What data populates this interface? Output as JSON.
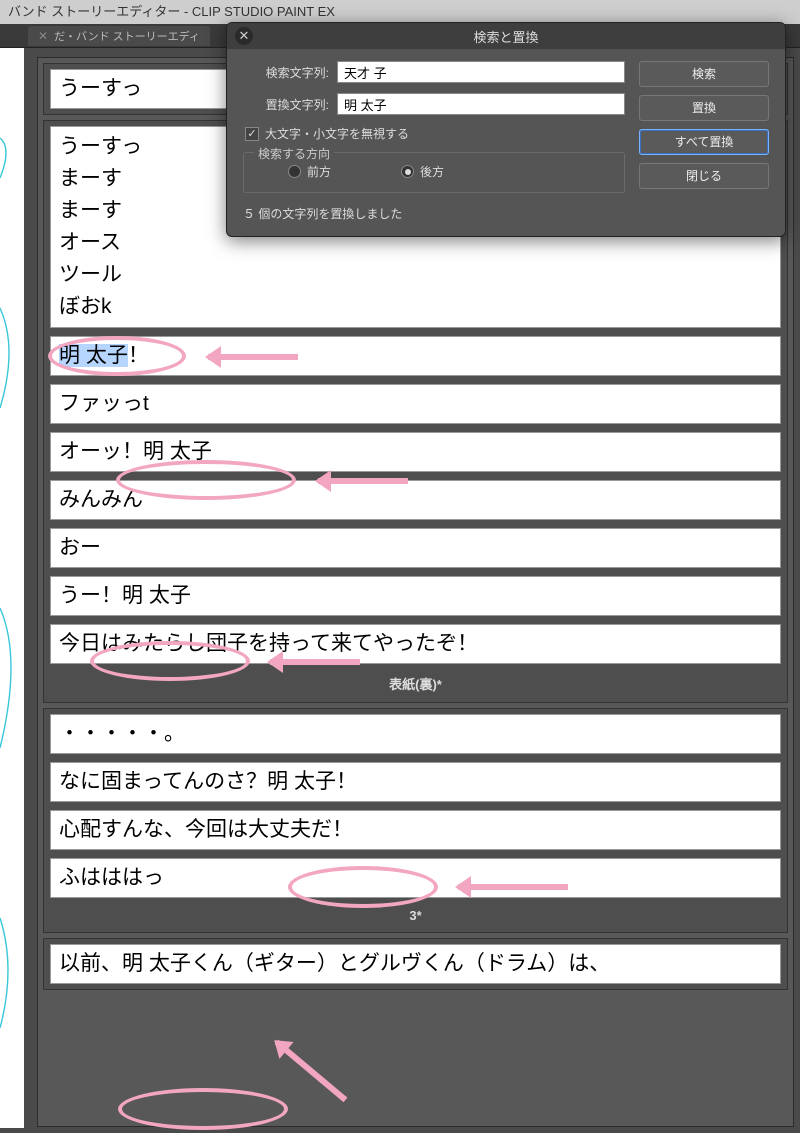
{
  "window": {
    "title": "バンド ストーリーエディター - CLIP STUDIO PAINT EX"
  },
  "tab": {
    "label": "だ・バンド ストーリーエディ"
  },
  "dialog": {
    "title": "検索と置換",
    "search_label": "検索文字列:",
    "replace_label": "置換文字列:",
    "search_value": "天才 子",
    "replace_value": "明 太子",
    "ignore_case_label": "大文字・小文字を無視する",
    "direction_legend": "検索する方向",
    "direction_forward": "前方",
    "direction_backward": "後方",
    "status": "５ 個の文字列を置換しました",
    "btn_search": "検索",
    "btn_replace": "置換",
    "btn_replace_all": "すべて置換",
    "btn_close": "閉じる"
  },
  "pages": [
    {
      "label": null,
      "boxes": [
        {
          "lines": [
            "うーすっ"
          ]
        }
      ]
    },
    {
      "label": "表紙(裏)*",
      "boxes": [
        {
          "lines": [
            "うーすっ",
            "まーす",
            "まーす",
            "オース",
            "ツール",
            "ぼおk"
          ]
        },
        {
          "lines": [
            "明 太子！"
          ],
          "highlight": "明 太子"
        },
        {
          "lines": [
            "ファッっt"
          ]
        },
        {
          "lines": [
            "オーッ！明 太子"
          ]
        },
        {
          "lines": [
            "みんみん"
          ]
        },
        {
          "lines": [
            "おー"
          ]
        },
        {
          "lines": [
            "うー！明 太子"
          ]
        },
        {
          "lines": [
            "今日はみたらし団子を持って来てやったぞ！"
          ]
        }
      ]
    },
    {
      "label": "3*",
      "boxes": [
        {
          "lines": [
            "・・・・・。"
          ]
        },
        {
          "lines": [
            "なに固まってんのさ？明 太子！"
          ]
        },
        {
          "lines": [
            "心配すんな、今回は大丈夫だ！"
          ]
        },
        {
          "lines": [
            "ふはははっ"
          ]
        }
      ]
    },
    {
      "label": null,
      "boxes": [
        {
          "lines": [
            "以前、明 太子くん（ギター）とグルヴくん（ドラム）は、"
          ]
        }
      ]
    }
  ]
}
